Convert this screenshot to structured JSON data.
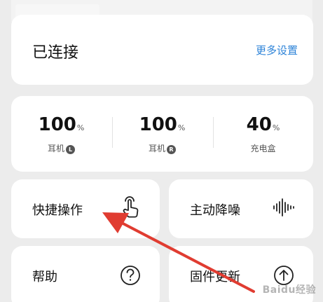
{
  "connection": {
    "status_label": "已连接",
    "more_settings_label": "更多设置"
  },
  "battery": {
    "items": [
      {
        "value": "100",
        "unit": "%",
        "label": "耳机",
        "badge": "L"
      },
      {
        "value": "100",
        "unit": "%",
        "label": "耳机",
        "badge": "R"
      },
      {
        "value": "40",
        "unit": "%",
        "label": "充电盒",
        "badge": ""
      }
    ]
  },
  "tiles": {
    "quick_actions": {
      "label": "快捷操作",
      "icon": "tap-gesture-icon"
    },
    "noise_control": {
      "label": "主动降噪",
      "icon": "sound-wave-icon"
    },
    "help": {
      "label": "帮助",
      "icon": "question-circle-icon"
    },
    "firmware_update": {
      "label": "固件更新",
      "icon": "upload-circle-icon"
    }
  },
  "watermark": {
    "text": "Baidu经验"
  },
  "colors": {
    "accent": "#2d83d8",
    "annotation_arrow": "#e03c31",
    "card_background": "#ffffff",
    "page_background": "#ececec"
  }
}
